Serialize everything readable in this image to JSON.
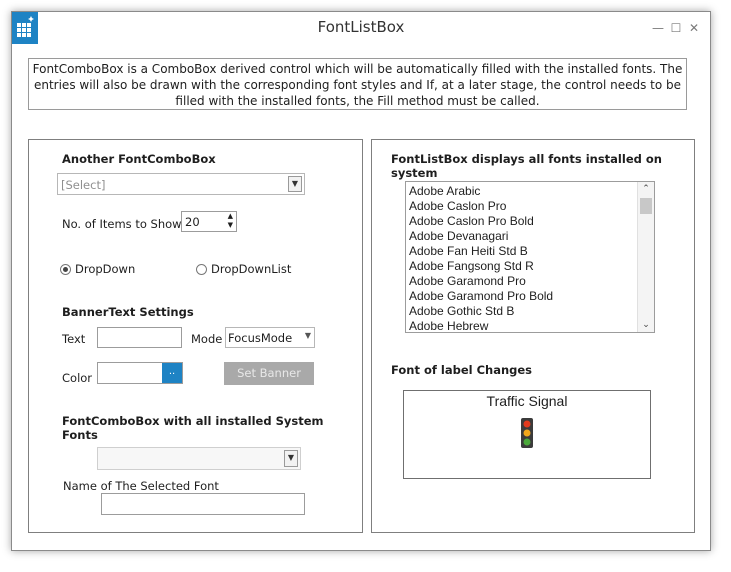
{
  "window": {
    "title": "FontListBox",
    "controls": {
      "minimize": "—",
      "maximize": "☐",
      "close": "✕"
    }
  },
  "description": "FontComboBox is a ComboBox derived control which will be automatically filled with the installed fonts. The entries will also be drawn with the corresponding font styles and If, at a later stage, the control needs to be filled with the installed fonts, the Fill method must be called.",
  "left_panel": {
    "another_header": "Another FontComboBox",
    "select_placeholder": "[Select]",
    "items_label": "No. of Items to Show:",
    "items_value": "20",
    "radio_dropdown": "DropDown",
    "radio_dropdownlist": "DropDownList",
    "banner_header": "BannerText Settings",
    "text_label": "Text",
    "mode_label": "Mode",
    "mode_value": "FocusMode",
    "color_label": "Color",
    "color_button": "..",
    "set_banner": "Set Banner",
    "system_fonts_header": "FontComboBox with all installed System Fonts",
    "selected_font_label": "Name of The Selected Font"
  },
  "right_panel": {
    "list_header": "FontListBox displays all fonts installed on system",
    "fonts": [
      "Adobe Arabic",
      "Adobe Caslon Pro",
      "Adobe Caslon Pro Bold",
      "Adobe Devanagari",
      "Adobe Fan Heiti Std B",
      "Adobe Fangsong Std R",
      "Adobe Garamond Pro",
      "Adobe Garamond Pro Bold",
      "Adobe Gothic Std B",
      "Adobe Hebrew"
    ],
    "label_changes_header": "Font of label Changes",
    "traffic_label": "Traffic Signal"
  },
  "colors": {
    "accent": "#1e83c4",
    "disabled_button": "#a9a9a9",
    "light_red": "#e23a1e",
    "light_amber": "#f2a71b",
    "light_green": "#4aa83a"
  },
  "icons": [
    "app-grid-icon",
    "minimize-icon",
    "maximize-icon",
    "close-icon",
    "dropdown-arrow-icon",
    "spin-up-icon",
    "spin-down-icon",
    "scroll-up-icon",
    "scroll-down-icon",
    "traffic-light-icon"
  ]
}
